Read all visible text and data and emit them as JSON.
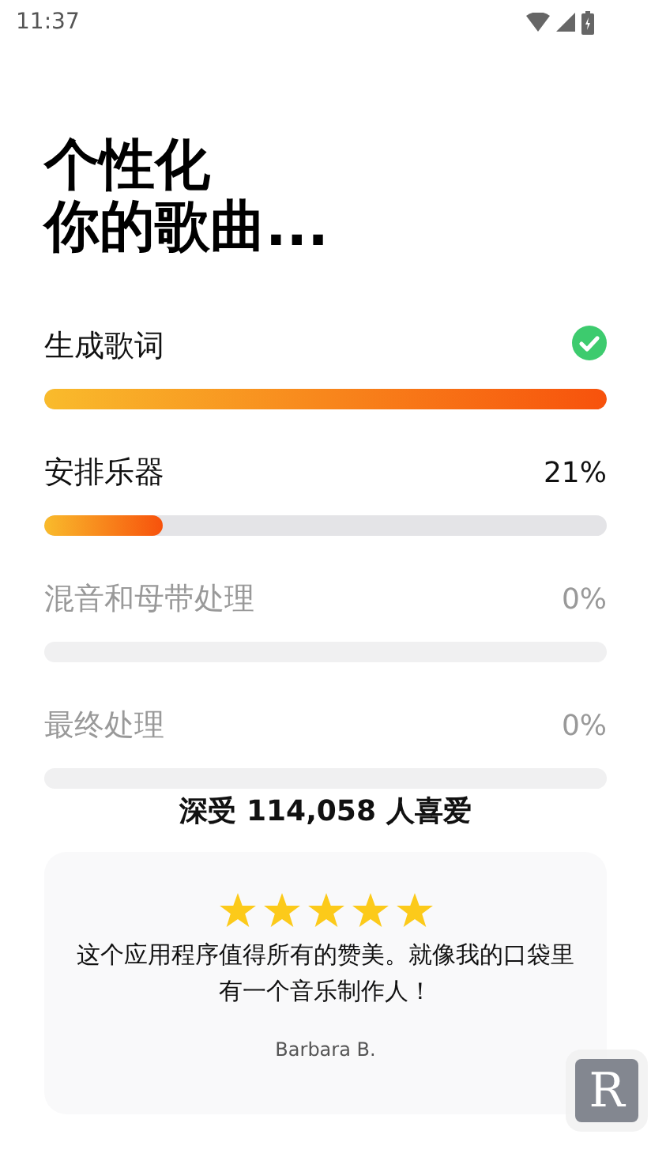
{
  "status_bar": {
    "time": "11:37"
  },
  "title": [
    "个性化",
    "你的歌曲..."
  ],
  "steps": [
    {
      "label": "生成歌词",
      "kind": "done",
      "active": true,
      "level": 1
    },
    {
      "label": "安排乐器",
      "kind": "progress",
      "active": true,
      "level": 0.21,
      "reading": "21%"
    },
    {
      "label": "混音和母带处理",
      "kind": "progress",
      "active": false,
      "level": 0,
      "reading": "0%"
    },
    {
      "label": "最终处理",
      "kind": "progress",
      "active": false,
      "level": 0,
      "reading": "0%"
    }
  ],
  "loved_by": "深受 114,058 人喜爱",
  "review": {
    "stars": 5,
    "text": "这个应用程序值得所有的赞美。就像我的口袋里有一个音乐制作人！",
    "author": "Barbara B."
  },
  "floating_button": {
    "label": "R"
  }
}
